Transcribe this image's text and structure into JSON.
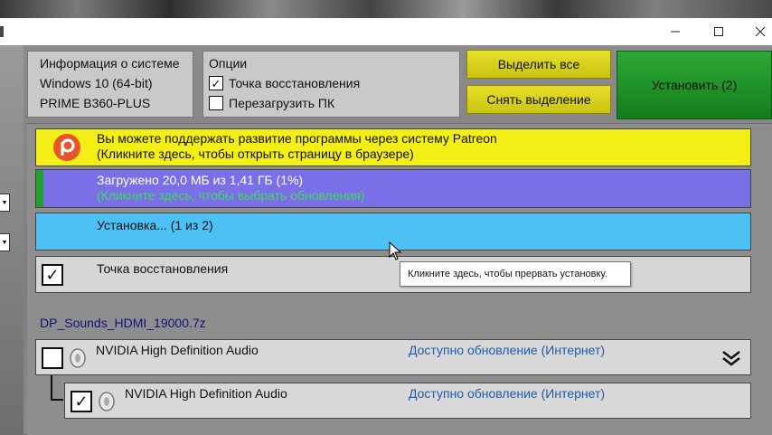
{
  "window": {
    "minimize_icon": "minimize-icon",
    "maximize_icon": "maximize-icon",
    "close_icon": "close-icon"
  },
  "system_info": {
    "title": "Информация о системе",
    "os": "Windows 10 (64-bit)",
    "board": "PRIME B360-PLUS"
  },
  "options": {
    "title": "Опции",
    "restore_point_label": "Точка восстановления",
    "restore_point_checked": true,
    "reboot_label": "Перезагрузить ПК",
    "reboot_checked": false
  },
  "buttons": {
    "select_all": "Выделить все",
    "deselect": "Снять выделение",
    "install": "Установить (2)"
  },
  "patreon": {
    "line1": "Вы можете поддержать развитие программы через систему Patreon",
    "line2": "(Кликните здесь, чтобы открыть страницу в браузере)"
  },
  "download": {
    "line1": "Загружено 20,0 МБ из 1,41 ГБ (1%)",
    "line2": "(Кликните здесь, чтобы выбрать обновления)",
    "progress": 0.01
  },
  "install_status": "Установка...  (1 из 2)",
  "restore_bar": {
    "label": "Точка восстановления",
    "checked": true
  },
  "tooltip": "Кликните здесь, чтобы прервать установку.",
  "package": {
    "name": "DP_Sounds_HDMI_19000.7z",
    "devices": [
      {
        "name": "NVIDIA High Definition Audio",
        "status": "Доступно обновление (Интернет)",
        "checked": false
      },
      {
        "name": "NVIDIA High Definition Audio",
        "status": "Доступно обновление (Интернет)",
        "checked": true
      }
    ]
  },
  "colors": {
    "patreon_bar": "#f2ee16",
    "download_bar": "#7b6fe8",
    "install_bar": "#4dc0f4",
    "install_button": "#1f9a28",
    "status_link": "#1f5ca8"
  }
}
